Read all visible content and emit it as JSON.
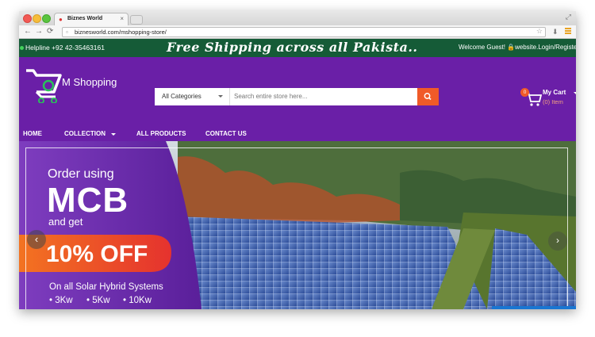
{
  "browser": {
    "tab_title": "Biznes World",
    "tab_close": "×",
    "url": "biznesworld.com/mshopping-store/"
  },
  "topbar": {
    "helpline": "Helpline +92 42-35463161",
    "shipping": "Free Shipping across all Pakista..",
    "welcome": "Welcome Guest!",
    "login": "website.Login/Register"
  },
  "header": {
    "logo_text": "M Shopping",
    "category_select": "All Categories",
    "search_placeholder": "Search entire store here...",
    "cart_count": "0",
    "cart_label": "My Cart",
    "cart_items": "(0) Item"
  },
  "nav": {
    "items": [
      "HOME",
      "COLLECTION",
      "ALL PRODUCTS",
      "CONTACT US"
    ]
  },
  "banner": {
    "line1": "Order using",
    "line2": "MCB",
    "line3": "and get",
    "offer": "10% OFF",
    "subtitle": "On all Solar Hybrid Systems",
    "options": [
      "• 3Kw",
      "• 5Kw",
      "• 10Kw"
    ]
  },
  "colors": {
    "header_purple": "#6a1fa7",
    "topbar_green": "#155b37",
    "accent_orange": "#f05a28"
  },
  "icons": [
    "favicon-icon",
    "back-icon",
    "forward-icon",
    "reload-icon",
    "page-icon",
    "star-icon",
    "extension-icon",
    "menu-icon",
    "lock-icon",
    "cart-logo-icon",
    "search-icon",
    "cart-icon",
    "prev-arrow-icon",
    "next-arrow-icon"
  ]
}
